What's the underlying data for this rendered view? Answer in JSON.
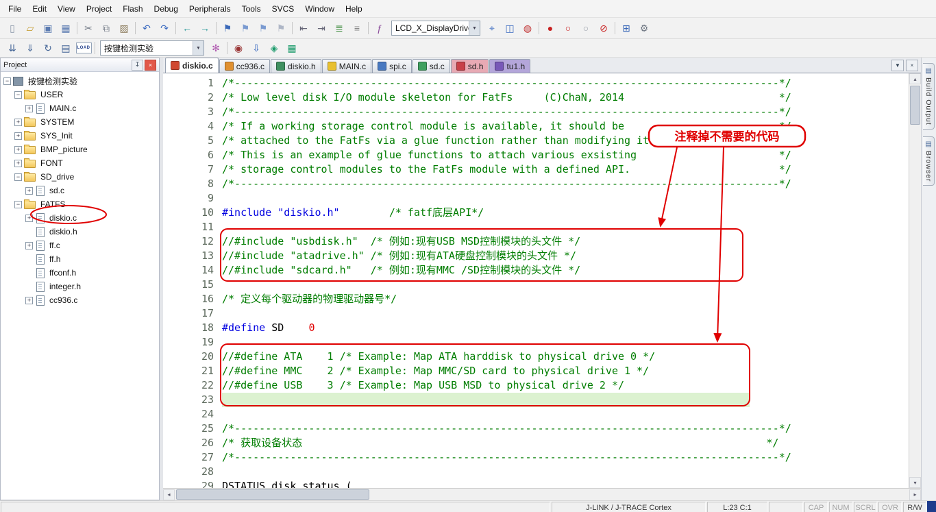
{
  "menu_bar": {
    "items": [
      "File",
      "Edit",
      "View",
      "Project",
      "Flash",
      "Debug",
      "Peripherals",
      "Tools",
      "SVCS",
      "Window",
      "Help"
    ]
  },
  "toolbar_main": {
    "items": [
      {
        "name": "new-file-button",
        "glyph": "▯",
        "color": "#8a97a8"
      },
      {
        "name": "open-file-button",
        "glyph": "▱",
        "color": "#c8a23c"
      },
      {
        "name": "save-button",
        "glyph": "▣",
        "color": "#5a7ab0"
      },
      {
        "name": "save-all-button",
        "glyph": "▦",
        "color": "#5a7ab0"
      },
      {
        "sep": true
      },
      {
        "name": "cut-button",
        "glyph": "✂",
        "color": "#707884"
      },
      {
        "name": "copy-button",
        "glyph": "⧉",
        "color": "#707884"
      },
      {
        "name": "paste-button",
        "glyph": "▨",
        "color": "#8a7a5a"
      },
      {
        "sep": true
      },
      {
        "name": "undo-button",
        "glyph": "↶",
        "color": "#3a6ac0"
      },
      {
        "name": "redo-button",
        "glyph": "↷",
        "color": "#3a6ac0"
      },
      {
        "sep": true
      },
      {
        "name": "navigate-back-button",
        "glyph": "←",
        "color": "#2a9a9a"
      },
      {
        "name": "navigate-forward-button",
        "glyph": "→",
        "color": "#2a9a9a"
      },
      {
        "sep": true
      },
      {
        "name": "toggle-bookmark-button",
        "glyph": "⚑",
        "color": "#3a68b8"
      },
      {
        "name": "prev-bookmark-button",
        "glyph": "⚑",
        "color": "#7a9ad0"
      },
      {
        "name": "next-bookmark-button",
        "glyph": "⚑",
        "color": "#7a9ad0"
      },
      {
        "name": "clear-bookmarks-button",
        "glyph": "⚑",
        "color": "#aeb6c6"
      },
      {
        "sep": true
      },
      {
        "name": "unindent-button",
        "glyph": "⇤",
        "color": "#667"
      },
      {
        "name": "indent-button",
        "glyph": "⇥",
        "color": "#667"
      },
      {
        "name": "comment-button",
        "glyph": "≣",
        "color": "#3a8a3a"
      },
      {
        "name": "uncomment-button",
        "glyph": "≡",
        "color": "#888"
      },
      {
        "sep": true
      },
      {
        "name": "function-list-button",
        "glyph": "ƒ",
        "color": "#8a4a9a"
      },
      {
        "combo": true,
        "name": "search-combo",
        "value": "LCD_X_DisplayDriver",
        "width": 128
      },
      {
        "name": "find-next-button",
        "glyph": "⌖",
        "color": "#3a6ac0"
      },
      {
        "name": "find-in-files-button",
        "glyph": "◫",
        "color": "#3a6ac0"
      },
      {
        "name": "search-magnifier-button",
        "glyph": "◍",
        "color": "#c03030"
      },
      {
        "sep": true
      },
      {
        "name": "insert-breakpoint-button",
        "glyph": "●",
        "color": "#c82020"
      },
      {
        "name": "enable-breakpoint-button",
        "glyph": "○",
        "color": "#c82020"
      },
      {
        "name": "disable-all-breakpoints-button",
        "glyph": "○",
        "color": "#9aa0aa"
      },
      {
        "name": "kill-all-breakpoints-button",
        "glyph": "⊘",
        "color": "#c82020"
      },
      {
        "sep": true
      },
      {
        "name": "window-layout-button",
        "glyph": "⊞",
        "color": "#3a68b8"
      },
      {
        "name": "configure-button",
        "glyph": "⚙",
        "color": "#707884"
      }
    ]
  },
  "toolbar_build": {
    "items": [
      {
        "name": "translate-file-button",
        "glyph": "⇊",
        "color": "#4a6a9a"
      },
      {
        "name": "build-button",
        "glyph": "⇓",
        "color": "#4a6a9a"
      },
      {
        "name": "rebuild-button",
        "glyph": "↻",
        "color": "#4a6a9a"
      },
      {
        "name": "batch-build-button",
        "glyph": "▤",
        "color": "#4a6a9a"
      },
      {
        "name": "load-button",
        "glyph": "LOAD",
        "text_icon": true
      },
      {
        "sep": true
      },
      {
        "combo": true,
        "name": "target-select-combo",
        "value": "按键检测实验",
        "width": 150
      },
      {
        "name": "options-for-target-button",
        "glyph": "✻",
        "color": "#b05ab0"
      },
      {
        "sep": true
      },
      {
        "name": "debug-session-button",
        "glyph": "◉",
        "color": "#993333"
      },
      {
        "name": "flash-download-button",
        "glyph": "⇩",
        "color": "#3a6ac0"
      },
      {
        "name": "manage-rte-button",
        "glyph": "◈",
        "color": "#1a9a6a"
      },
      {
        "name": "pack-installer-button",
        "glyph": "▦",
        "color": "#1a9a6a"
      }
    ]
  },
  "project": {
    "title": "Project",
    "tree": [
      {
        "label": "按键检测实验",
        "depth": 0,
        "type": "target",
        "expander": "minus"
      },
      {
        "label": "USER",
        "depth": 1,
        "type": "folder",
        "expander": "minus"
      },
      {
        "label": "MAIN.c",
        "depth": 2,
        "type": "file",
        "expander": "plus"
      },
      {
        "label": "SYSTEM",
        "depth": 1,
        "type": "folder",
        "expander": "plus"
      },
      {
        "label": "SYS_Init",
        "depth": 1,
        "type": "folder",
        "expander": "plus"
      },
      {
        "label": "BMP_picture",
        "depth": 1,
        "type": "folder",
        "expander": "plus"
      },
      {
        "label": "FONT",
        "depth": 1,
        "type": "folder",
        "expander": "plus"
      },
      {
        "label": "SD_drive",
        "depth": 1,
        "type": "folder",
        "expander": "minus"
      },
      {
        "label": "sd.c",
        "depth": 2,
        "type": "file",
        "expander": "plus"
      },
      {
        "label": "FATFS",
        "depth": 1,
        "type": "folder",
        "expander": "minus"
      },
      {
        "label": "diskio.c",
        "depth": 2,
        "type": "file",
        "expander": "plus"
      },
      {
        "label": "diskio.h",
        "depth": 2,
        "type": "file"
      },
      {
        "label": "ff.c",
        "depth": 2,
        "type": "file",
        "expander": "plus"
      },
      {
        "label": "ff.h",
        "depth": 2,
        "type": "file"
      },
      {
        "label": "ffconf.h",
        "depth": 2,
        "type": "file"
      },
      {
        "label": "integer.h",
        "depth": 2,
        "type": "file"
      },
      {
        "label": "cc936.c",
        "depth": 2,
        "type": "file",
        "expander": "plus"
      }
    ]
  },
  "editor": {
    "tabs": [
      {
        "label": "diskio.c",
        "icon_color": "#d04830",
        "active": true
      },
      {
        "label": "cc936.c",
        "icon_color": "#e09030"
      },
      {
        "label": "diskio.h",
        "icon_color": "#409060"
      },
      {
        "label": "MAIN.c",
        "icon_color": "#e8c030"
      },
      {
        "label": "spi.c",
        "icon_color": "#4878c0"
      },
      {
        "label": "sd.c",
        "icon_color": "#40a060"
      },
      {
        "label": "sd.h",
        "icon_color": "#c84048",
        "bg": "#e8aab4"
      },
      {
        "label": "tu1.h",
        "icon_color": "#7858b8",
        "bg": "#b4a6da"
      }
    ],
    "lines": [
      {
        "n": 1,
        "segs": [
          [
            "c",
            "/*----------------------------------------------------------------------------------------*/"
          ]
        ]
      },
      {
        "n": 2,
        "segs": [
          [
            "c",
            "/* Low level disk I/O module skeleton for FatFs     (C)ChaN, 2014                         */"
          ]
        ]
      },
      {
        "n": 3,
        "segs": [
          [
            "c",
            "/*----------------------------------------------------------------------------------------*/"
          ]
        ]
      },
      {
        "n": 4,
        "segs": [
          [
            "c",
            "/* If a working storage control module is available, it should be                         */"
          ]
        ]
      },
      {
        "n": 5,
        "segs": [
          [
            "c",
            "/* attached to the FatFs via a glue function rather than modifying it.                    */"
          ]
        ]
      },
      {
        "n": 6,
        "segs": [
          [
            "c",
            "/* This is an example of glue functions to attach various exsisting                       */"
          ]
        ]
      },
      {
        "n": 7,
        "segs": [
          [
            "c",
            "/* storage control modules to the FatFs module with a defined API.                        */"
          ]
        ]
      },
      {
        "n": 8,
        "segs": [
          [
            "c",
            "/*----------------------------------------------------------------------------------------*/"
          ]
        ]
      },
      {
        "n": 9,
        "segs": []
      },
      {
        "n": 10,
        "segs": [
          [
            "k",
            "#include "
          ],
          [
            "s",
            "\"diskio.h\""
          ],
          [
            "p",
            "        "
          ],
          [
            "c",
            "/* fatf底层API*/"
          ]
        ]
      },
      {
        "n": 11,
        "segs": []
      },
      {
        "n": 12,
        "segs": [
          [
            "c",
            "//#include \"usbdisk.h\"  /* 例如:现有USB MSD控制模块的头文件 */"
          ]
        ]
      },
      {
        "n": 13,
        "segs": [
          [
            "c",
            "//#include \"atadrive.h\" /* 例如:现有ATA硬盘控制模块的头文件 */"
          ]
        ]
      },
      {
        "n": 14,
        "segs": [
          [
            "c",
            "//#include \"sdcard.h\"   /* 例如:现有MMC /SD控制模块的头文件 */"
          ]
        ]
      },
      {
        "n": 15,
        "segs": []
      },
      {
        "n": 16,
        "segs": [
          [
            "c",
            "/* 定义每个驱动器的物理驱动器号*/"
          ]
        ]
      },
      {
        "n": 17,
        "segs": []
      },
      {
        "n": 18,
        "segs": [
          [
            "k",
            "#define"
          ],
          [
            "p",
            " SD    "
          ],
          [
            "n",
            "0"
          ]
        ]
      },
      {
        "n": 19,
        "segs": []
      },
      {
        "n": 20,
        "segs": [
          [
            "c",
            "//#define ATA    1 /* Example: Map ATA harddisk to physical drive 0 */"
          ]
        ]
      },
      {
        "n": 21,
        "segs": [
          [
            "c",
            "//#define MMC    2 /* Example: Map MMC/SD card to physical drive 1 */"
          ]
        ]
      },
      {
        "n": 22,
        "segs": [
          [
            "c",
            "//#define USB    3 /* Example: Map USB MSD to physical drive 2 */"
          ]
        ]
      },
      {
        "n": 23,
        "segs": [],
        "highlight": true
      },
      {
        "n": 24,
        "segs": []
      },
      {
        "n": 25,
        "segs": [
          [
            "c",
            "/*----------------------------------------------------------------------------------------*/"
          ]
        ]
      },
      {
        "n": 26,
        "segs": [
          [
            "c",
            "/* 获取设备状态                                                                           */"
          ]
        ]
      },
      {
        "n": 27,
        "segs": [
          [
            "c",
            "/*----------------------------------------------------------------------------------------*/"
          ]
        ]
      },
      {
        "n": 28,
        "segs": []
      },
      {
        "n": 29,
        "segs": [
          [
            "p",
            "DSTATUS disk_status ("
          ]
        ]
      }
    ]
  },
  "annotation": {
    "callout": "注释掉不需要的代码"
  },
  "dock": {
    "tabs": [
      {
        "label": "Build Output"
      },
      {
        "label": "Browser"
      }
    ]
  },
  "status_bar": {
    "debugger": "J-LINK / J-TRACE Cortex",
    "cursor": "L:23 C:1",
    "locks": [
      "CAP",
      "NUM",
      "SCRL",
      "OVR",
      "R/W"
    ]
  }
}
